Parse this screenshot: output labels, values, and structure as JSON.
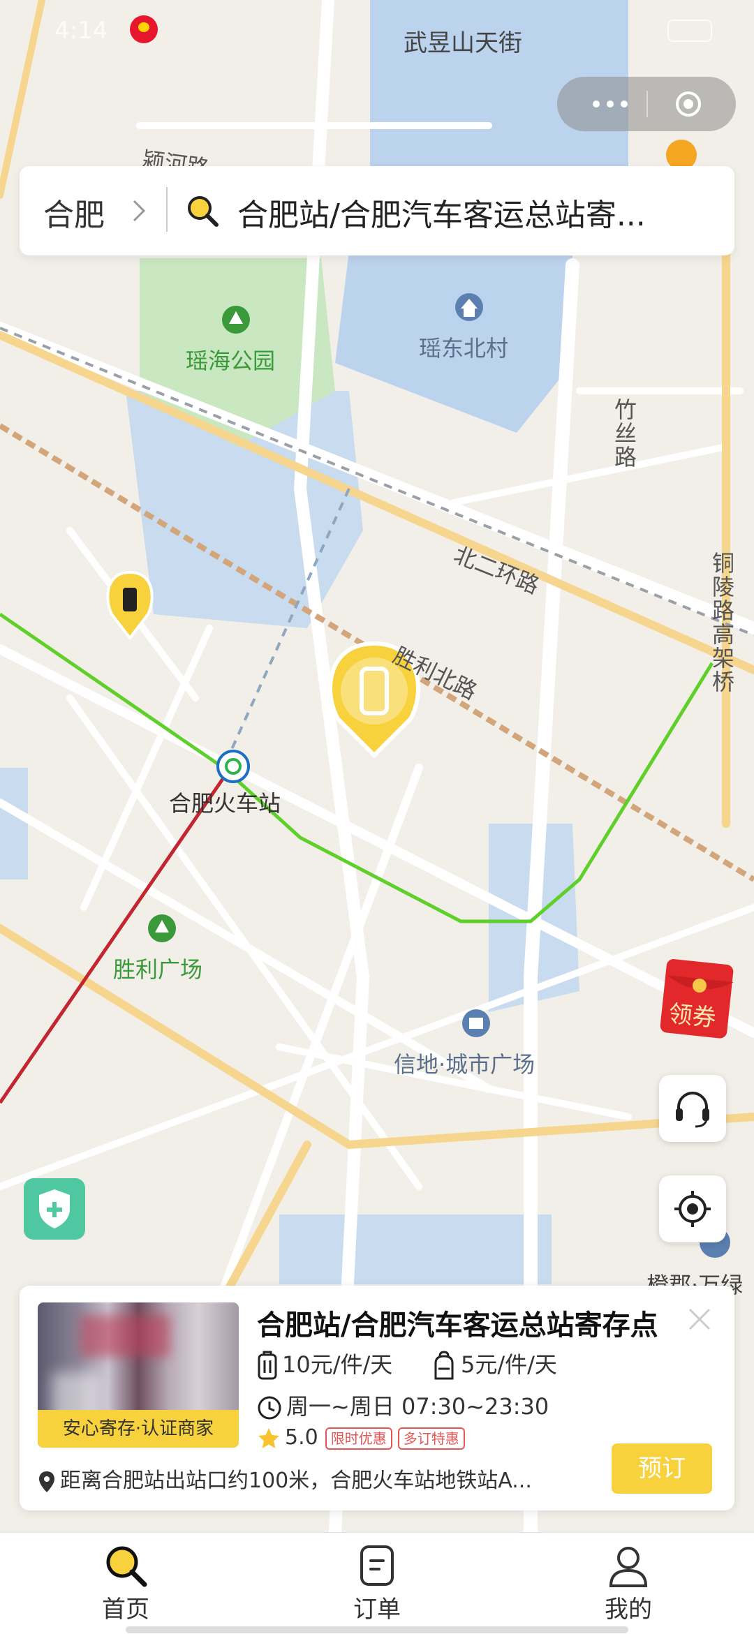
{
  "status_bar": {
    "time": "4:14"
  },
  "search": {
    "city": "合肥",
    "query": "合肥站/合肥汽车客运总站寄..."
  },
  "map": {
    "labels": {
      "street_top": "武昱山天街",
      "street_yinghe": "颍河路",
      "park_yaohai": "瑶海公园",
      "village": "瑶东北村",
      "road_zhusi": "竹丝路",
      "road_beier": "北二环路",
      "road_tongling": "铜陵路高架桥",
      "road_shengli": "胜利北路",
      "station": "合肥火车站",
      "square": "胜利广场",
      "plaza": "信地·城市广场",
      "corner": "橙郡·万绿"
    },
    "route_colors": {
      "line_green": "#5fcf2a",
      "line_red": "#c4262f",
      "rail": "#d2a57a",
      "marker": "#f7d23c"
    }
  },
  "floating": {
    "coupon_label": "领券",
    "customer_service_icon": "headset-icon",
    "locate_icon": "locate-icon",
    "safety_icon": "shield-plus-icon"
  },
  "card": {
    "title": "合肥站/合肥汽车客运总站寄存点",
    "badge": "安心寄存·认证商家",
    "price_large": "10元/件/天",
    "price_small": "5元/件/天",
    "hours": "周一~周日 07:30~23:30",
    "rating": "5.0",
    "tags": [
      "限时优惠",
      "多订特惠"
    ],
    "address": "距离合肥站出站口约100米，合肥火车站地铁站A...",
    "book_label": "预订"
  },
  "tabs": [
    {
      "label": "首页",
      "icon": "search-icon",
      "active": true
    },
    {
      "label": "订单",
      "icon": "order-icon",
      "active": false
    },
    {
      "label": "我的",
      "icon": "user-icon",
      "active": false
    }
  ]
}
